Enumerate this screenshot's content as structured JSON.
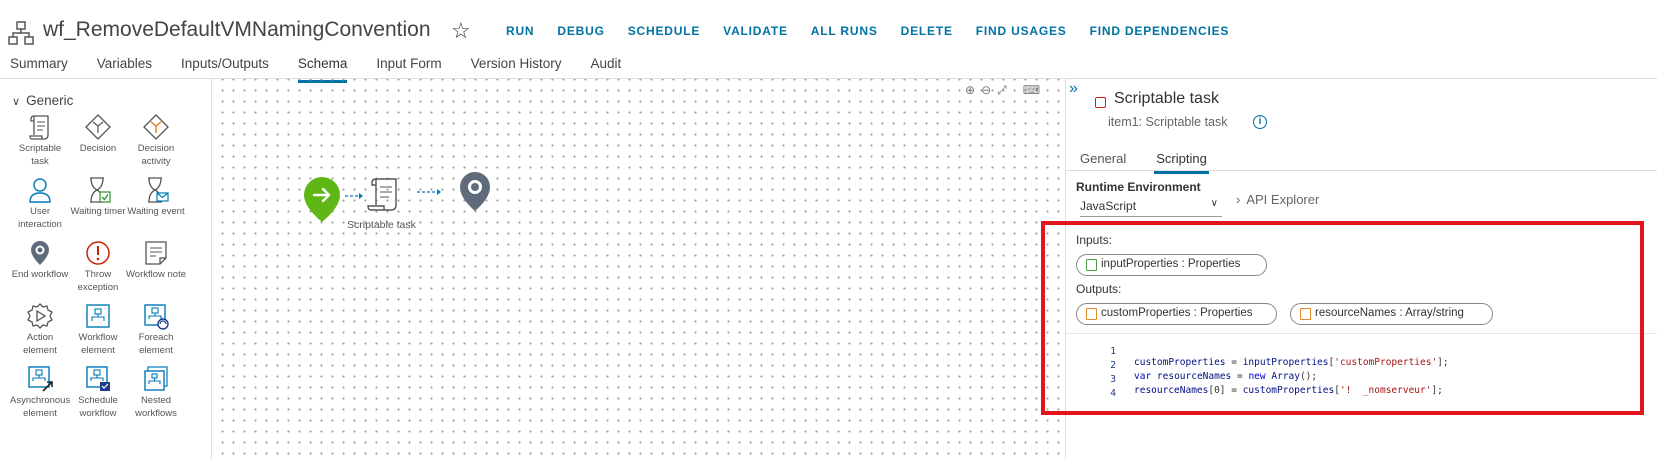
{
  "header": {
    "title": "wf_RemoveDefaultVMNamingConvention",
    "actions": [
      "RUN",
      "DEBUG",
      "SCHEDULE",
      "VALIDATE",
      "ALL RUNS",
      "DELETE",
      "FIND USAGES",
      "FIND DEPENDENCIES"
    ]
  },
  "tabs": [
    "Summary",
    "Variables",
    "Inputs/Outputs",
    "Schema",
    "Input Form",
    "Version History",
    "Audit"
  ],
  "active_tab": "Schema",
  "palette": {
    "group": "Generic",
    "items": [
      {
        "label": "Scriptable task",
        "icon": "scroll-icon"
      },
      {
        "label": "Decision",
        "icon": "decision-icon"
      },
      {
        "label": "Decision activity",
        "icon": "decision-activity-icon"
      },
      {
        "label": "User interaction",
        "icon": "user-icon"
      },
      {
        "label": "Waiting timer",
        "icon": "hourglass-timer-icon"
      },
      {
        "label": "Waiting event",
        "icon": "hourglass-event-icon"
      },
      {
        "label": "End workflow",
        "icon": "end-pin-icon"
      },
      {
        "label": "Throw exception",
        "icon": "exception-icon"
      },
      {
        "label": "Workflow note",
        "icon": "note-icon"
      },
      {
        "label": "Action element",
        "icon": "gear-icon"
      },
      {
        "label": "Workflow element",
        "icon": "workflow-icon"
      },
      {
        "label": "Foreach element",
        "icon": "foreach-icon"
      },
      {
        "label": "Asynchronous element",
        "icon": "async-icon"
      },
      {
        "label": "Schedule workflow",
        "icon": "schedule-icon"
      },
      {
        "label": "Nested workflows",
        "icon": "nested-icon"
      }
    ]
  },
  "canvas": {
    "node_label": "Scriptable task"
  },
  "panel": {
    "title": "Scriptable task",
    "subtitle": "item1: Scriptable task",
    "tabs": [
      "General",
      "Scripting"
    ],
    "active_tab": "Scripting",
    "runtime_label": "Runtime Environment",
    "runtime_value": "JavaScript",
    "api_explorer": "API Explorer",
    "inputs_label": "Inputs:",
    "inputs": [
      "inputProperties : Properties"
    ],
    "outputs_label": "Outputs:",
    "outputs": [
      "customProperties : Properties",
      "resourceNames : Array/string"
    ],
    "code_line_numbers": [
      "1",
      "2",
      "3",
      "4"
    ]
  },
  "colors": {
    "accent": "#0072a3",
    "highlight": "#e3141c",
    "start_node": "#5eb715",
    "end_node": "#5f6b7a"
  }
}
